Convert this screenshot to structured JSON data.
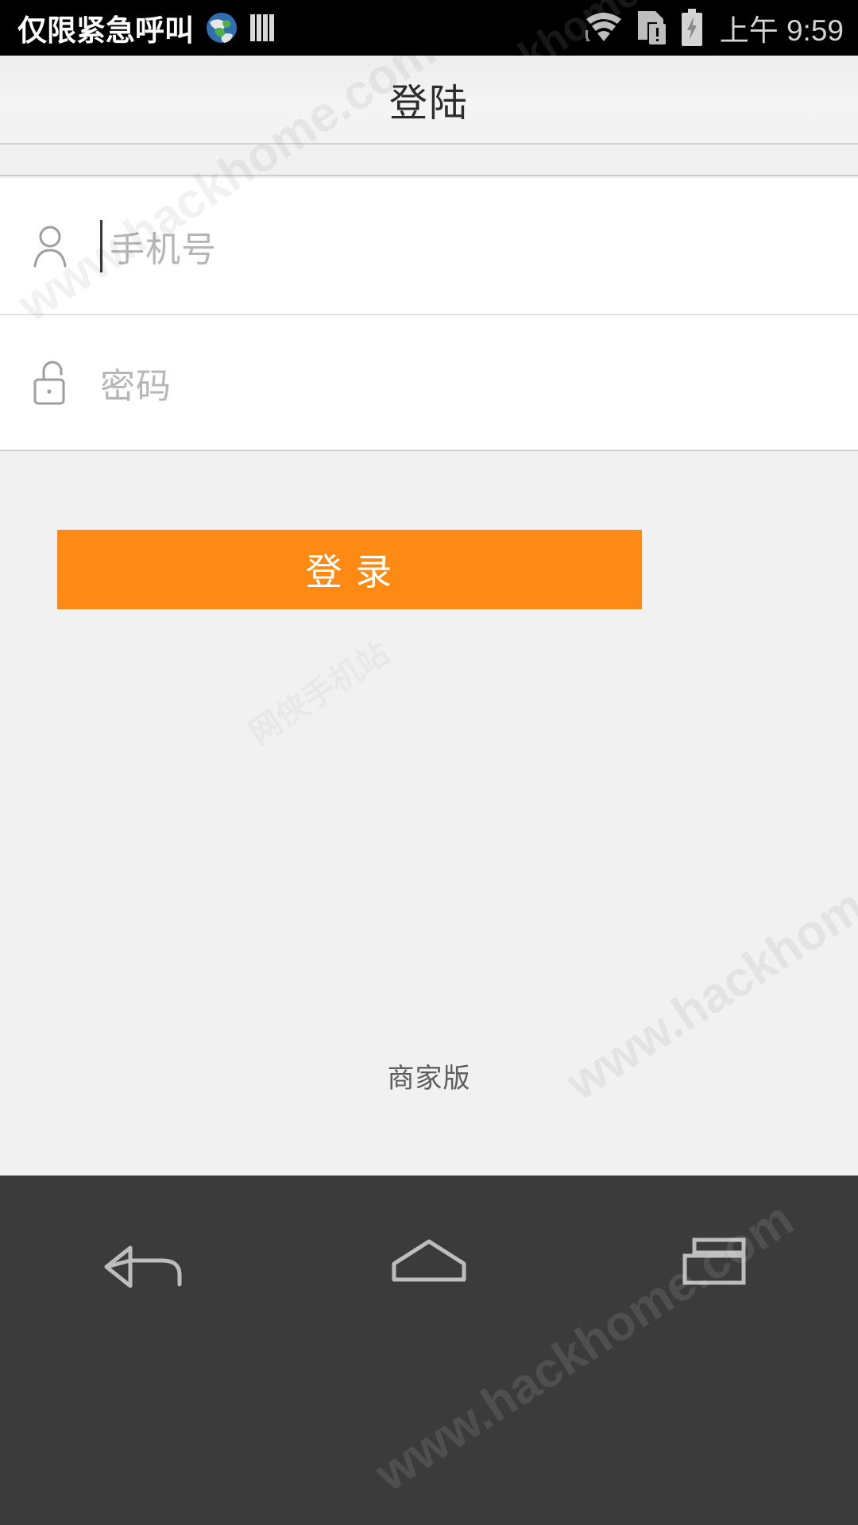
{
  "status_bar": {
    "carrier": "仅限紧急呼叫",
    "clock": "上午 9:59",
    "icons": {
      "globe": "globe-icon",
      "signal_bars": "signal-bars-icon",
      "wifi": "wifi-icon",
      "sim_warning": "sim-card-warning-icon",
      "battery_charging": "battery-charging-icon"
    },
    "background_color": "#000000",
    "text_color": "#ffffff"
  },
  "title_bar": {
    "title": "登陆"
  },
  "form": {
    "phone_field": {
      "icon": "person-icon",
      "placeholder": "手机号",
      "value": "",
      "focused": true
    },
    "password_field": {
      "icon": "lock-open-icon",
      "placeholder": "密码",
      "value": "",
      "focused": false
    }
  },
  "login_button": {
    "label": "登 录",
    "color": "#fc8a14",
    "text_color": "#ffffff"
  },
  "footer": {
    "label": "商家版"
  },
  "nav_bar": {
    "background_color": "#3b3b3b",
    "buttons": [
      {
        "name": "back",
        "icon": "back-arrow-icon"
      },
      {
        "name": "home",
        "icon": "home-icon"
      },
      {
        "name": "recents",
        "icon": "recent-apps-icon"
      }
    ]
  },
  "watermarks": {
    "primary": "www.hackhome.com",
    "secondary": "www.hackhome.com",
    "faint": "网侠手机站"
  }
}
